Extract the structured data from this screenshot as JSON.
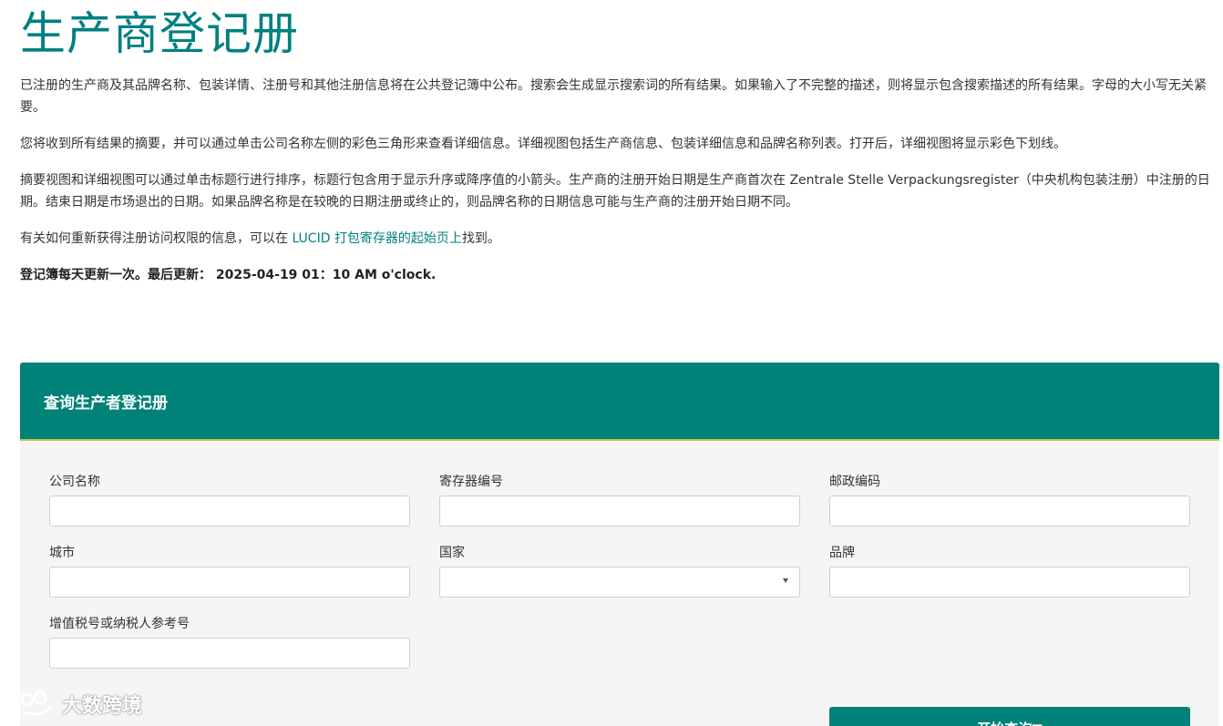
{
  "page": {
    "title": "生产商登记册"
  },
  "intro": {
    "p1": "已注册的生产商及其品牌名称、包装详情、注册号和其他注册信息将在公共登记簿中公布。搜索会生成显示搜索词的所有结果。如果输入了不完整的描述，则将显示包含搜索描述的所有结果。字母的大小写无关紧要。",
    "p2": "您将收到所有结果的摘要，并可以通过单击公司名称左侧的彩色三角形来查看详细信息。详细视图包括生产商信息、包装详细信息和品牌名称列表。打开后，详细视图将显示彩色下划线。",
    "p3": "摘要视图和详细视图可以通过单击标题行进行排序，标题行包含用于显示升序或降序值的小箭头。生产商的注册开始日期是生产商首次在 Zentrale Stelle Verpackungsregister（中央机构包装注册）中注册的日期。结束日期是市场退出的日期。如果品牌名称是在较晚的日期注册或终止的，则品牌名称的日期信息可能与生产商的注册开始日期不同。",
    "p4_before": "有关如何重新获得注册访问权限的信息，可以在 ",
    "p4_link": "LUCID 打包寄存器的起始页上",
    "p4_after": "找到。",
    "updated": "登记簿每天更新一次。最后更新： 2025-04-19 01：10 AM o'clock."
  },
  "panel": {
    "title": "查询生产者登记册",
    "fields": {
      "company_name": {
        "label": "公司名称",
        "value": ""
      },
      "register_number": {
        "label": "寄存器编号",
        "value": ""
      },
      "postal_code": {
        "label": "邮政编码",
        "value": ""
      },
      "city": {
        "label": "城市",
        "value": ""
      },
      "country": {
        "label": "国家",
        "value": ""
      },
      "brand": {
        "label": "品牌",
        "value": ""
      },
      "vat_number": {
        "label": "增值税号或纳税人参考号",
        "value": ""
      }
    },
    "search_label": "开始查询▼"
  },
  "watermark": {
    "text": "大数跨境"
  },
  "colors": {
    "accent": "#008080",
    "header_bg": "#008278",
    "header_border": "#c9c44a",
    "panel_bg": "#f5f5f5"
  }
}
